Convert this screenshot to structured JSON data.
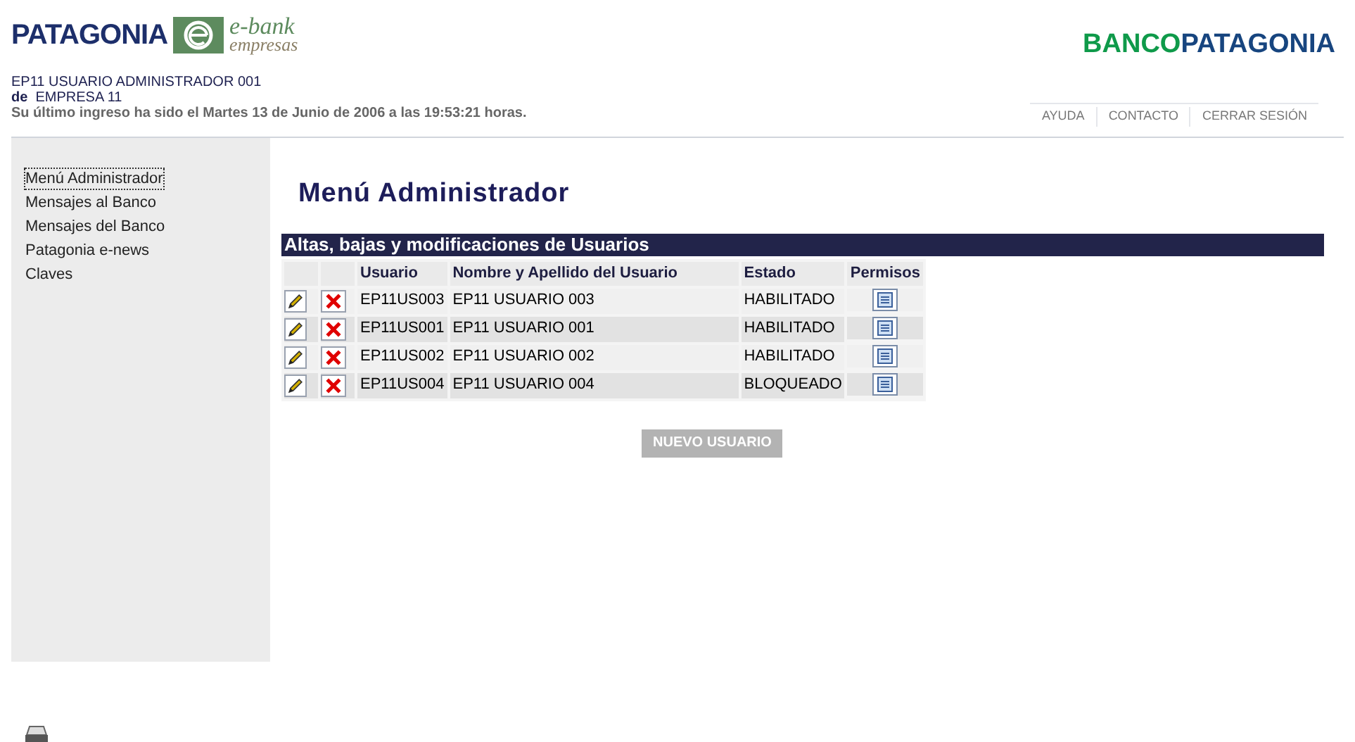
{
  "header": {
    "brand": "PATAGONIA",
    "ebank": "e-bank",
    "ebank_sub": "empresas",
    "bank_logo_a": "BANCO",
    "bank_logo_b": "PATAGONIA",
    "user": "EP11 USUARIO ADMINISTRADOR 001",
    "company_prefix": "de",
    "company": "EMPRESA 11",
    "last_login": "Su último ingreso ha sido el Martes 13 de Junio de 2006 a las 19:53:21 horas.",
    "links": [
      "AYUDA",
      "CONTACTO",
      "CERRAR SESIÓN"
    ]
  },
  "sidebar": {
    "items": [
      {
        "label": "Menú Administrador",
        "selected": true
      },
      {
        "label": "Mensajes al Banco",
        "selected": false
      },
      {
        "label": "Mensajes del Banco",
        "selected": false
      },
      {
        "label": "Patagonia e-news",
        "selected": false
      },
      {
        "label": "Claves",
        "selected": false
      }
    ]
  },
  "page_title": "Menú Administrador",
  "section_title": "Altas, bajas y modificaciones de Usuarios",
  "table": {
    "columns": [
      "Usuario",
      "Nombre y Apellido del Usuario",
      "Estado",
      "Permisos"
    ],
    "rows": [
      {
        "usuario": "EP11US003",
        "nombre": "EP11 USUARIO 003",
        "estado": "HABILITADO"
      },
      {
        "usuario": "EP11US001",
        "nombre": "EP11 USUARIO 001",
        "estado": "HABILITADO"
      },
      {
        "usuario": "EP11US002",
        "nombre": "EP11 USUARIO 002",
        "estado": "HABILITADO"
      },
      {
        "usuario": "EP11US004",
        "nombre": "EP11 USUARIO 004",
        "estado": "BLOQUEADO"
      }
    ]
  },
  "new_user_button": "NUEVO USUARIO"
}
